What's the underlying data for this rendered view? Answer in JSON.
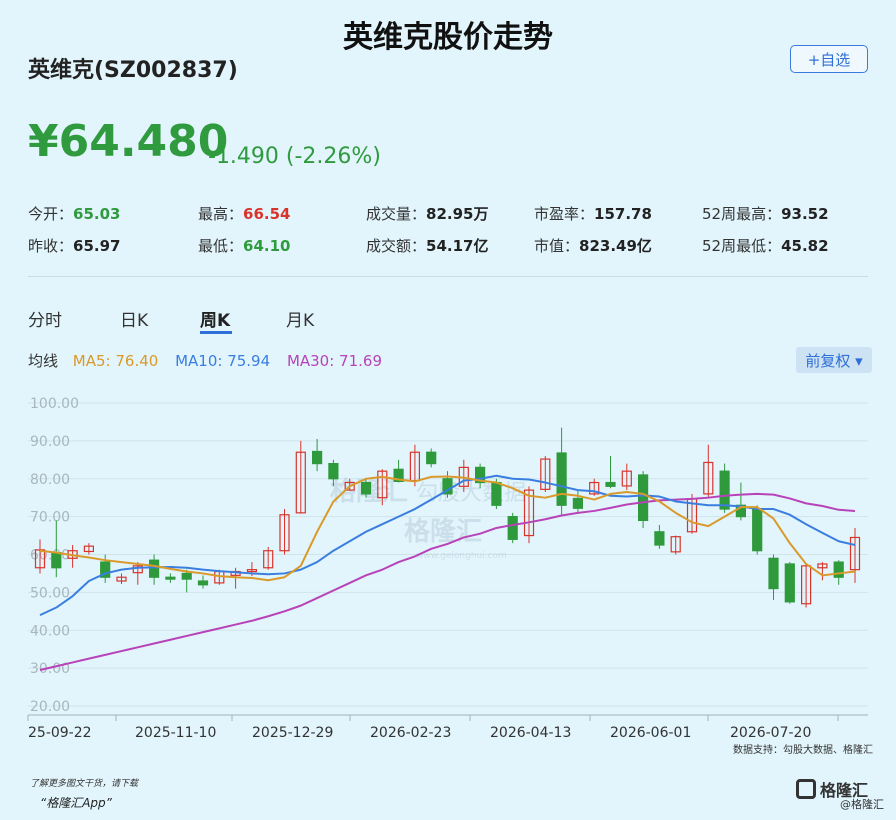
{
  "title": "英维克股价走势",
  "stock": {
    "name": "英维克(SZ002837)"
  },
  "add_watch_label": "+自选",
  "price": "¥64.480",
  "change": "-1.490  (-2.26%)",
  "stats": [
    {
      "label": "今开：",
      "value": "65.03",
      "color": "green"
    },
    {
      "label": "最高：",
      "value": "66.54",
      "color": "red"
    },
    {
      "label": "成交量：",
      "value": "82.95万",
      "color": "dark"
    },
    {
      "label": "市盈率：",
      "value": "157.78",
      "color": "dark"
    },
    {
      "label": "52周最高：",
      "value": "93.52",
      "color": "dark"
    },
    {
      "label": "昨收：",
      "value": "65.97",
      "color": "dark"
    },
    {
      "label": "最低：",
      "value": "64.10",
      "color": "green"
    },
    {
      "label": "成交额：",
      "value": "54.17亿",
      "color": "dark"
    },
    {
      "label": "市值：",
      "value": "823.49亿",
      "color": "dark"
    },
    {
      "label": "52周最低：",
      "value": "45.82",
      "color": "dark"
    }
  ],
  "tabs": [
    "分时",
    "日K",
    "周K",
    "月K"
  ],
  "active_tab": "周K",
  "ma": {
    "label": "均线",
    "ma5": "MA5: 76.40",
    "ma10": "MA10: 75.94",
    "ma30": "MA30: 71.69",
    "ma5_color": "#d99a2b",
    "ma10_color": "#3a7ee0",
    "ma30_color": "#b843b8"
  },
  "adjust_button": "前复权 ▾",
  "colors": {
    "up": "#d9342b",
    "down": "#2e9a3c",
    "accent": "#2f6fd8"
  },
  "watermark": {
    "brand": "格隆汇",
    "brand2": "勾股大数据",
    "url": "www.gelonghui.com"
  },
  "chart_data": {
    "type": "candlestick",
    "ylim": [
      20,
      100
    ],
    "y_ticks": [
      "100.00",
      "90.00",
      "80.00",
      "70.00",
      "60.00",
      "50.00",
      "40.00",
      "30.00",
      "20.00"
    ],
    "x_labels": [
      "25-09-22",
      "2025-11-10",
      "2025-12-29",
      "2026-02-23",
      "2026-04-13",
      "2026-06-01",
      "2026-07-20"
    ],
    "x_label_index": [
      0,
      7,
      14,
      21,
      28,
      35,
      42
    ],
    "candles": [
      [
        56.5,
        61.2,
        55,
        64
      ],
      [
        60.5,
        56.5,
        54,
        69
      ],
      [
        59,
        61,
        56.5,
        62.5
      ],
      [
        60.8,
        62.2,
        60,
        63
      ],
      [
        58,
        54,
        52.5,
        60
      ],
      [
        53,
        54,
        52.2,
        55
      ],
      [
        55.2,
        57,
        52,
        58
      ],
      [
        58.5,
        54,
        52,
        60
      ],
      [
        54,
        53.5,
        52.5,
        55
      ],
      [
        55,
        53.5,
        50,
        56
      ],
      [
        53,
        52,
        51,
        54.5
      ],
      [
        52.5,
        55.5,
        52,
        56
      ],
      [
        54.5,
        55.5,
        51,
        56.5
      ],
      [
        55.5,
        56,
        54.3,
        58
      ],
      [
        56.5,
        61,
        56,
        62
      ],
      [
        61,
        70.5,
        60,
        72
      ],
      [
        71,
        87,
        70.8,
        90
      ],
      [
        87.2,
        84,
        82,
        90.5
      ],
      [
        84,
        80,
        78,
        85
      ],
      [
        77,
        79,
        77,
        80
      ],
      [
        79,
        76,
        75,
        80
      ],
      [
        75,
        82,
        73,
        82.5
      ],
      [
        82.5,
        79.3,
        79,
        85
      ],
      [
        79.5,
        87,
        78,
        89
      ],
      [
        87,
        84,
        83,
        88
      ],
      [
        80,
        76,
        75,
        82
      ],
      [
        78,
        83,
        76.5,
        85
      ],
      [
        83,
        79,
        77.5,
        84
      ],
      [
        79,
        73,
        72,
        80
      ],
      [
        70,
        64,
        63,
        71
      ],
      [
        65,
        77,
        63,
        78
      ],
      [
        77.2,
        85.2,
        76.5,
        86
      ],
      [
        86.8,
        73,
        70.5,
        93.5
      ],
      [
        74.8,
        72.2,
        71,
        77
      ],
      [
        76,
        79,
        75.5,
        80
      ],
      [
        79,
        78,
        77.5,
        86
      ],
      [
        78.1,
        82,
        77,
        84
      ],
      [
        81,
        69,
        67,
        82
      ],
      [
        66,
        62.5,
        61.5,
        67.8
      ],
      [
        60.7,
        64.7,
        60,
        65
      ],
      [
        66,
        74.7,
        65.5,
        76
      ],
      [
        76,
        84.3,
        75,
        89
      ],
      [
        82,
        72,
        71,
        84
      ],
      [
        73,
        70,
        69,
        79
      ],
      [
        72,
        61,
        60,
        73
      ],
      [
        59,
        51,
        48,
        60
      ],
      [
        57.5,
        47.5,
        47,
        58
      ],
      [
        47,
        57,
        46,
        57.5
      ],
      [
        56.5,
        57.5,
        53.2,
        58
      ],
      [
        58,
        54,
        52,
        58.5
      ],
      [
        56,
        64.5,
        52.5,
        67
      ]
    ],
    "ma5": [
      61,
      60.5,
      59.8,
      59.2,
      58.5,
      58,
      57.5,
      57,
      56.2,
      55.5,
      55,
      54.3,
      54,
      53.8,
      53.2,
      54,
      57,
      66,
      74,
      78,
      80,
      80.5,
      79.8,
      79.3,
      80.5,
      80.6,
      80.3,
      79.5,
      79,
      77.5,
      75.5,
      75,
      76,
      75.5,
      74.5,
      76,
      76.5,
      76,
      74,
      71,
      68.5,
      67.5,
      70,
      72.5,
      72.5,
      69.5,
      63,
      57.5,
      54.5,
      55,
      55.5
    ],
    "ma10": [
      44,
      46,
      49,
      53,
      55,
      56,
      56.5,
      56.6,
      56.7,
      56.5,
      56,
      55.6,
      55.3,
      55,
      54.8,
      55,
      56,
      58,
      61,
      63.5,
      66,
      68,
      70,
      72,
      74.5,
      77,
      79.5,
      80,
      80.8,
      80,
      79.8,
      79,
      78,
      77,
      76.7,
      75.5,
      75.3,
      75.6,
      75.3,
      74,
      73.5,
      73,
      73,
      72.7,
      72,
      72,
      70.5,
      68,
      65.7,
      63.5,
      62.5
    ],
    "ma30": [
      29.5,
      30.5,
      31.5,
      32.5,
      33.5,
      34.5,
      35.5,
      36.5,
      37.5,
      38.5,
      39.5,
      40.5,
      41.5,
      42.5,
      43.7,
      45,
      46.5,
      48.5,
      50.5,
      52.5,
      54.5,
      56,
      58,
      59.5,
      61.5,
      62.8,
      64.5,
      65.5,
      67,
      67.8,
      68.5,
      69.3,
      70.3,
      71,
      71.5,
      72.3,
      73.2,
      73.8,
      74.3,
      74.5,
      74.7,
      75,
      75.5,
      75.8,
      76,
      75.8,
      74.8,
      73.5,
      72.8,
      71.8,
      71.5
    ]
  },
  "source_text": "数据支持：勾股大数据、格隆汇",
  "promo_line1": "了解更多图文干货，请下载",
  "promo_line2": "“格隆汇App”",
  "logo_text": "格隆汇",
  "sub_brand": "@格隆汇"
}
